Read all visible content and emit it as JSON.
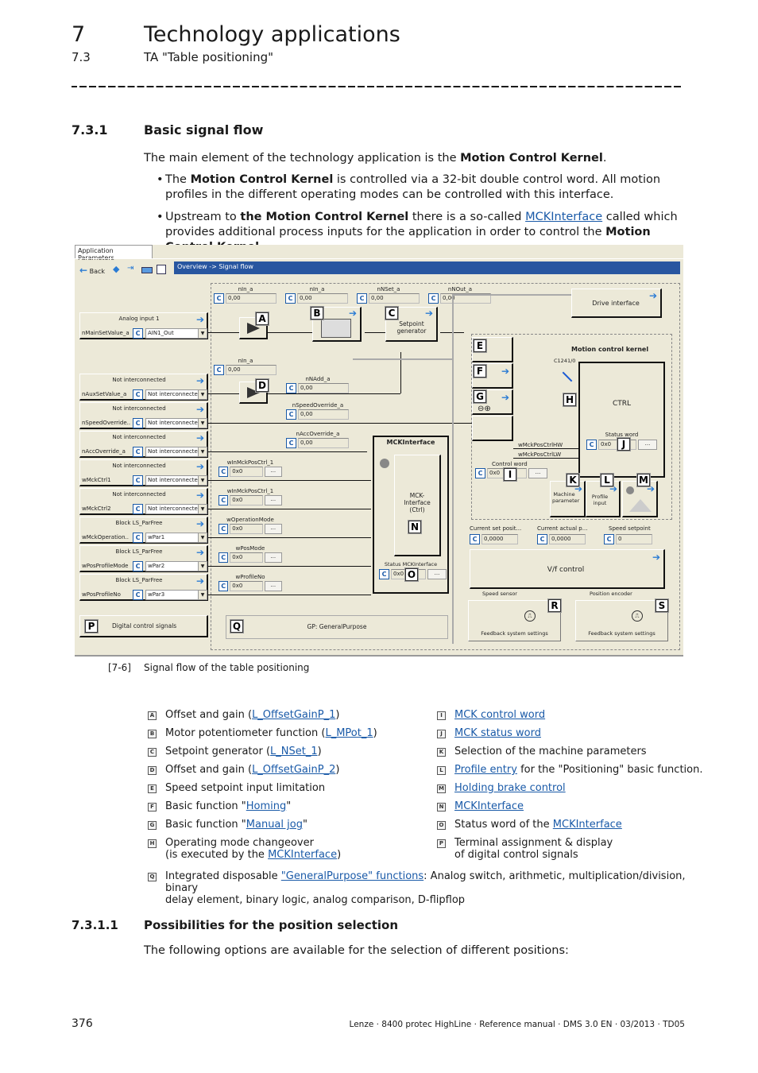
{
  "header": {
    "chapter_number": "7",
    "chapter_title": "Technology applications",
    "section_number": "7.3",
    "section_title": "TA \"Table positioning\""
  },
  "section": {
    "number": "7.3.1",
    "title": "Basic signal flow",
    "intro_pre": "The main element of the technology application is the ",
    "intro_bold": "Motion Control Kernel",
    "intro_post": ".",
    "bullets": [
      {
        "b1_pre": "The ",
        "b1_bold": "Motion Control Kernel",
        "b1_post": " is controlled via a 32-bit double control word. All motion profiles in the different operating modes can be controlled with this interface."
      },
      {
        "b2_pre": "Upstream to ",
        "b2_bold": "the Motion Control Kernel",
        "b2_mid": " there is a so-called ",
        "b2_link": "MCKInterface",
        "b2_post": " called  which provides additional process inputs for the application in order to control the ",
        "b2_bold2": "Motion Control Kernel",
        "b2_end": "."
      }
    ]
  },
  "diagram": {
    "tab_label": "Application Parameters",
    "toolbar": {
      "back_label": "Back"
    },
    "breadcrumb": "Overview -> Signal flow",
    "inputs": [
      {
        "title": "Analog input 1",
        "name": "nMainSetValue_a",
        "value": "AIN1_Out"
      },
      {
        "title": "Not interconnected",
        "name": "nAuxSetValue_a",
        "value": "Not interconnecte"
      },
      {
        "title": "Not interconnected",
        "name": "nSpeedOverride..",
        "value": "Not interconnecte"
      },
      {
        "title": "Not interconnected",
        "name": "nAccOverride_a",
        "value": "Not interconnecte"
      },
      {
        "title": "Not interconnected",
        "name": "wMckCtrl1",
        "value": "Not interconnecte"
      },
      {
        "title": "Not interconnected",
        "name": "wMckCtrl2",
        "value": "Not interconnecte"
      },
      {
        "title": "Block LS_ParFree",
        "name": "wMckOperation..",
        "value": "wPar1"
      },
      {
        "title": "Block LS_ParFree",
        "name": "wPosProfileMode",
        "value": "wPar2"
      },
      {
        "title": "Block LS_ParFree",
        "name": "wPosProfileNo",
        "value": "wPar3"
      }
    ],
    "monitors": [
      {
        "label": "nIn_a",
        "value": "0,00"
      },
      {
        "label": "nIn_a",
        "value": "0,00"
      },
      {
        "label": "nNSet_a",
        "value": "0,00"
      },
      {
        "label": "nNOut_a",
        "value": "0,00"
      },
      {
        "label": "nIn_a",
        "value": "0,00"
      },
      {
        "label": "nNAdd_a",
        "value": "0,00"
      },
      {
        "label": "nSpeedOverride_a",
        "value": "0,00"
      },
      {
        "label": "nAccOverride_a",
        "value": "0,00"
      },
      {
        "label": "wInMckPosCtrl_1",
        "value": "0x0"
      },
      {
        "label": "wInMckPosCtrl_1",
        "value": "0x0"
      },
      {
        "label": "wOperationMode",
        "value": "0x0"
      },
      {
        "label": "wPosMode",
        "value": "0x0"
      },
      {
        "label": "wProfileNo",
        "value": "0x0"
      }
    ],
    "c_button": "C",
    "dots_button": "...",
    "blocks": {
      "setpoint_generator": "Setpoint generator",
      "drive_interface": "Drive interface",
      "mck_title": "Motion control kernel",
      "ctrl": "CTRL",
      "c1241": "C1241/0",
      "status_word_label": "Status word",
      "status_word_value": "0x0",
      "mckinterface_title": "MCKInterface",
      "mckinterface_ctrl": "MCK-Interface (Ctrl)",
      "status_mckinterface_label": "Status MCKInterface",
      "status_mckinterface_value": "0x0",
      "control_word_label": "Control word",
      "control_word_value": "0x0",
      "wmckposctrlhw": "wMckPosCtrlHW",
      "wmckposctrllw": "wMckPosCtrlLW",
      "machine_param": "Machine parameter",
      "profile_input": "Profile input",
      "current_set_pos_label": "Current set posit...",
      "current_set_pos_value": "0,0000",
      "current_actual_label": "Current actual p...",
      "current_actual_value": "0,0000",
      "speed_setpoint_label": "Speed setpoint",
      "speed_setpoint_value": "0",
      "vf_control": "V/f control",
      "speed_sensor": "Speed sensor",
      "position_encoder": "Position encoder",
      "feedback_r": "Feedback system settings",
      "feedback_s": "Feedback system settings",
      "digital_control": "Digital control signals",
      "gp": "GP: GeneralPurpose"
    },
    "letters": [
      "A",
      "B",
      "C",
      "D",
      "E",
      "F",
      "G",
      "H",
      "I",
      "J",
      "K",
      "L",
      "M",
      "N",
      "O",
      "P",
      "Q",
      "R",
      "S"
    ]
  },
  "caption": {
    "number": "[7-6]",
    "text": "Signal flow of the table positioning"
  },
  "legend": {
    "left": [
      {
        "key": "A",
        "pre": "Offset and gain (",
        "link": "L_OffsetGainP_1",
        "post": ")"
      },
      {
        "key": "B",
        "pre": "Motor potentiometer function (",
        "link": "L_MPot_1",
        "post": ")"
      },
      {
        "key": "C",
        "pre": "Setpoint generator (",
        "link": "L_NSet_1",
        "post": ")"
      },
      {
        "key": "D",
        "pre": "Offset and gain (",
        "link": "L_OffsetGainP_2",
        "post": ")"
      },
      {
        "key": "E",
        "pre": "Speed setpoint input limitation",
        "link": "",
        "post": ""
      },
      {
        "key": "F",
        "pre": "Basic function \"",
        "link": "Homing",
        "post": "\""
      },
      {
        "key": "G",
        "pre": "Basic function \"",
        "link": "Manual jog",
        "post": "\""
      },
      {
        "key": "H",
        "pre": "Operating mode changeover",
        "line2_pre": "(is executed by the ",
        "link": "MCKInterface",
        "post": ")"
      }
    ],
    "right": [
      {
        "key": "I",
        "pre": "",
        "link": "MCK control word",
        "post": ""
      },
      {
        "key": "J",
        "pre": "",
        "link": "MCK status word",
        "post": ""
      },
      {
        "key": "K",
        "pre": "Selection of the machine parameters",
        "link": "",
        "post": ""
      },
      {
        "key": "L",
        "pre": "",
        "link": "Profile entry",
        "post": " for the \"Positioning\" basic function."
      },
      {
        "key": "M",
        "pre": "",
        "link": "Holding brake control",
        "post": ""
      },
      {
        "key": "N",
        "pre": "",
        "link": "MCKInterface",
        "post": ""
      },
      {
        "key": "O",
        "pre": "Status word of the ",
        "link": "MCKInterface",
        "post": ""
      },
      {
        "key": "P",
        "pre": "Terminal assignment & display",
        "line2_pre": "of digital control signals",
        "link": "",
        "post": ""
      }
    ],
    "q": {
      "key": "Q",
      "pre": "Integrated disposable ",
      "link": "\"GeneralPurpose\" functions",
      "post": ": Analog switch, arithmetic, multiplication/division, binary",
      "line2": "delay element, binary logic, analog comparison, D-flipflop"
    }
  },
  "subsection": {
    "number": "7.3.1.1",
    "title": "Possibilities for the position selection",
    "text": "The following options are available for the selection of different positions:"
  },
  "footer": {
    "page": "376",
    "text": "Lenze · 8400 protec HighLine · Reference manual · DMS 3.0 EN · 03/2013 · TD05"
  }
}
